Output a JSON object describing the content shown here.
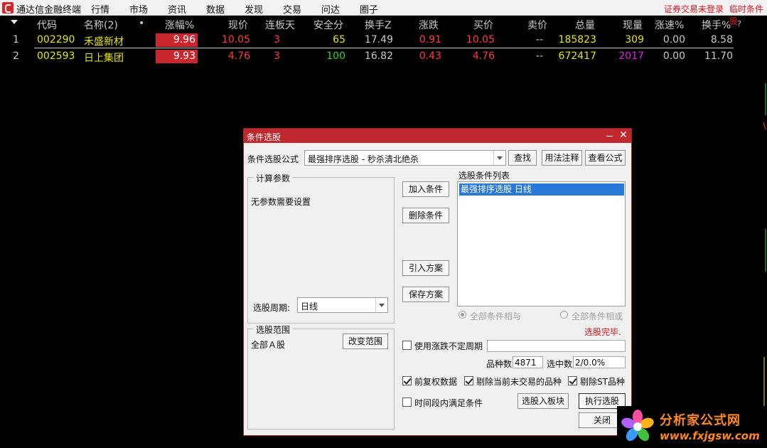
{
  "app": {
    "title": "通达信金融终端",
    "menu": [
      "行情",
      "市场",
      "资讯",
      "数据",
      "发现",
      "交易",
      "问达",
      "圈子"
    ],
    "status_login": "证券交易未登录",
    "status_cond": "临时条件股"
  },
  "table": {
    "headers": {
      "code": "代码",
      "name": "名称(2)",
      "dot": "•",
      "pct": "涨幅%",
      "price": "现价",
      "limit_days": "连板天",
      "score": "安全分",
      "turnover_z": "换手Z",
      "change": "涨跌",
      "bid": "买价",
      "ask": "卖价",
      "volume": "总量",
      "cur_vol": "现量",
      "speed": "涨速%",
      "turnover": "换手%",
      "help": "?"
    },
    "rows": [
      {
        "idx": "1",
        "code": "002290",
        "name": "禾盛新材",
        "pct": "9.96",
        "price": "10.05",
        "limit_days": "3",
        "score": "65",
        "turnover_z": "17.49",
        "change": "0.91",
        "bid": "10.05",
        "ask": "--",
        "volume": "185823",
        "cur_vol": "309",
        "speed": "0.00",
        "turnover": "8.58"
      },
      {
        "idx": "2",
        "code": "002593",
        "name": "日上集团",
        "pct": "9.93",
        "price": "4.76",
        "limit_days": "3",
        "score": "100",
        "turnover_z": "16.82",
        "change": "0.43",
        "bid": "4.76",
        "ask": "--",
        "volume": "672417",
        "cur_vol": "2017",
        "speed": "0.00",
        "turnover": "11.70"
      }
    ]
  },
  "dialog": {
    "title": "条件选股",
    "formula_label": "条件选股公式",
    "formula_value": "最强排序选股 - 秒杀清北绝杀",
    "btn_find": "查找",
    "btn_usage": "用法注释",
    "btn_view": "查看公式",
    "params_group": "计算参数",
    "params_text": "无参数需要设置",
    "period_label": "选股周期:",
    "period_value": "日线",
    "btn_add": "加入条件",
    "btn_delete": "删除条件",
    "btn_import": "引入方案",
    "btn_save": "保存方案",
    "cond_list_label": "选股条件列表",
    "cond_items": [
      "最强排序选股  日线"
    ],
    "radio_and": "全部条件相与",
    "radio_or": "全部条件相或",
    "status": "选股完毕.",
    "range_group": "选股范围",
    "range_value": "全部Ａ股",
    "btn_change_range": "改变范围",
    "use_period_label": "使用涨跌不定周期",
    "count_label": "品种数",
    "count_value": "4871",
    "selected_label": "选中数",
    "selected_value": "2/0.0%",
    "chk_adjust": "前复权数据",
    "chk_exclude_untraded": "剔除当前未交易的品种",
    "chk_exclude_st": "剔除ST品种",
    "chk_time_range": "时间段内满足条件",
    "btn_to_block": "选股入板块",
    "btn_execute": "执行选股",
    "btn_close": "关闭"
  },
  "watermark": {
    "name": "分析家公式网",
    "url": "www.fxjgsw.com"
  },
  "colors": {
    "up": "#ff3b3b",
    "yellow": "#e6e600",
    "green": "#2fd22f",
    "magenta": "#e020e0",
    "header": "#c8c8c8",
    "dialog_title": "#c0282d",
    "selection": "#2a78d8"
  }
}
